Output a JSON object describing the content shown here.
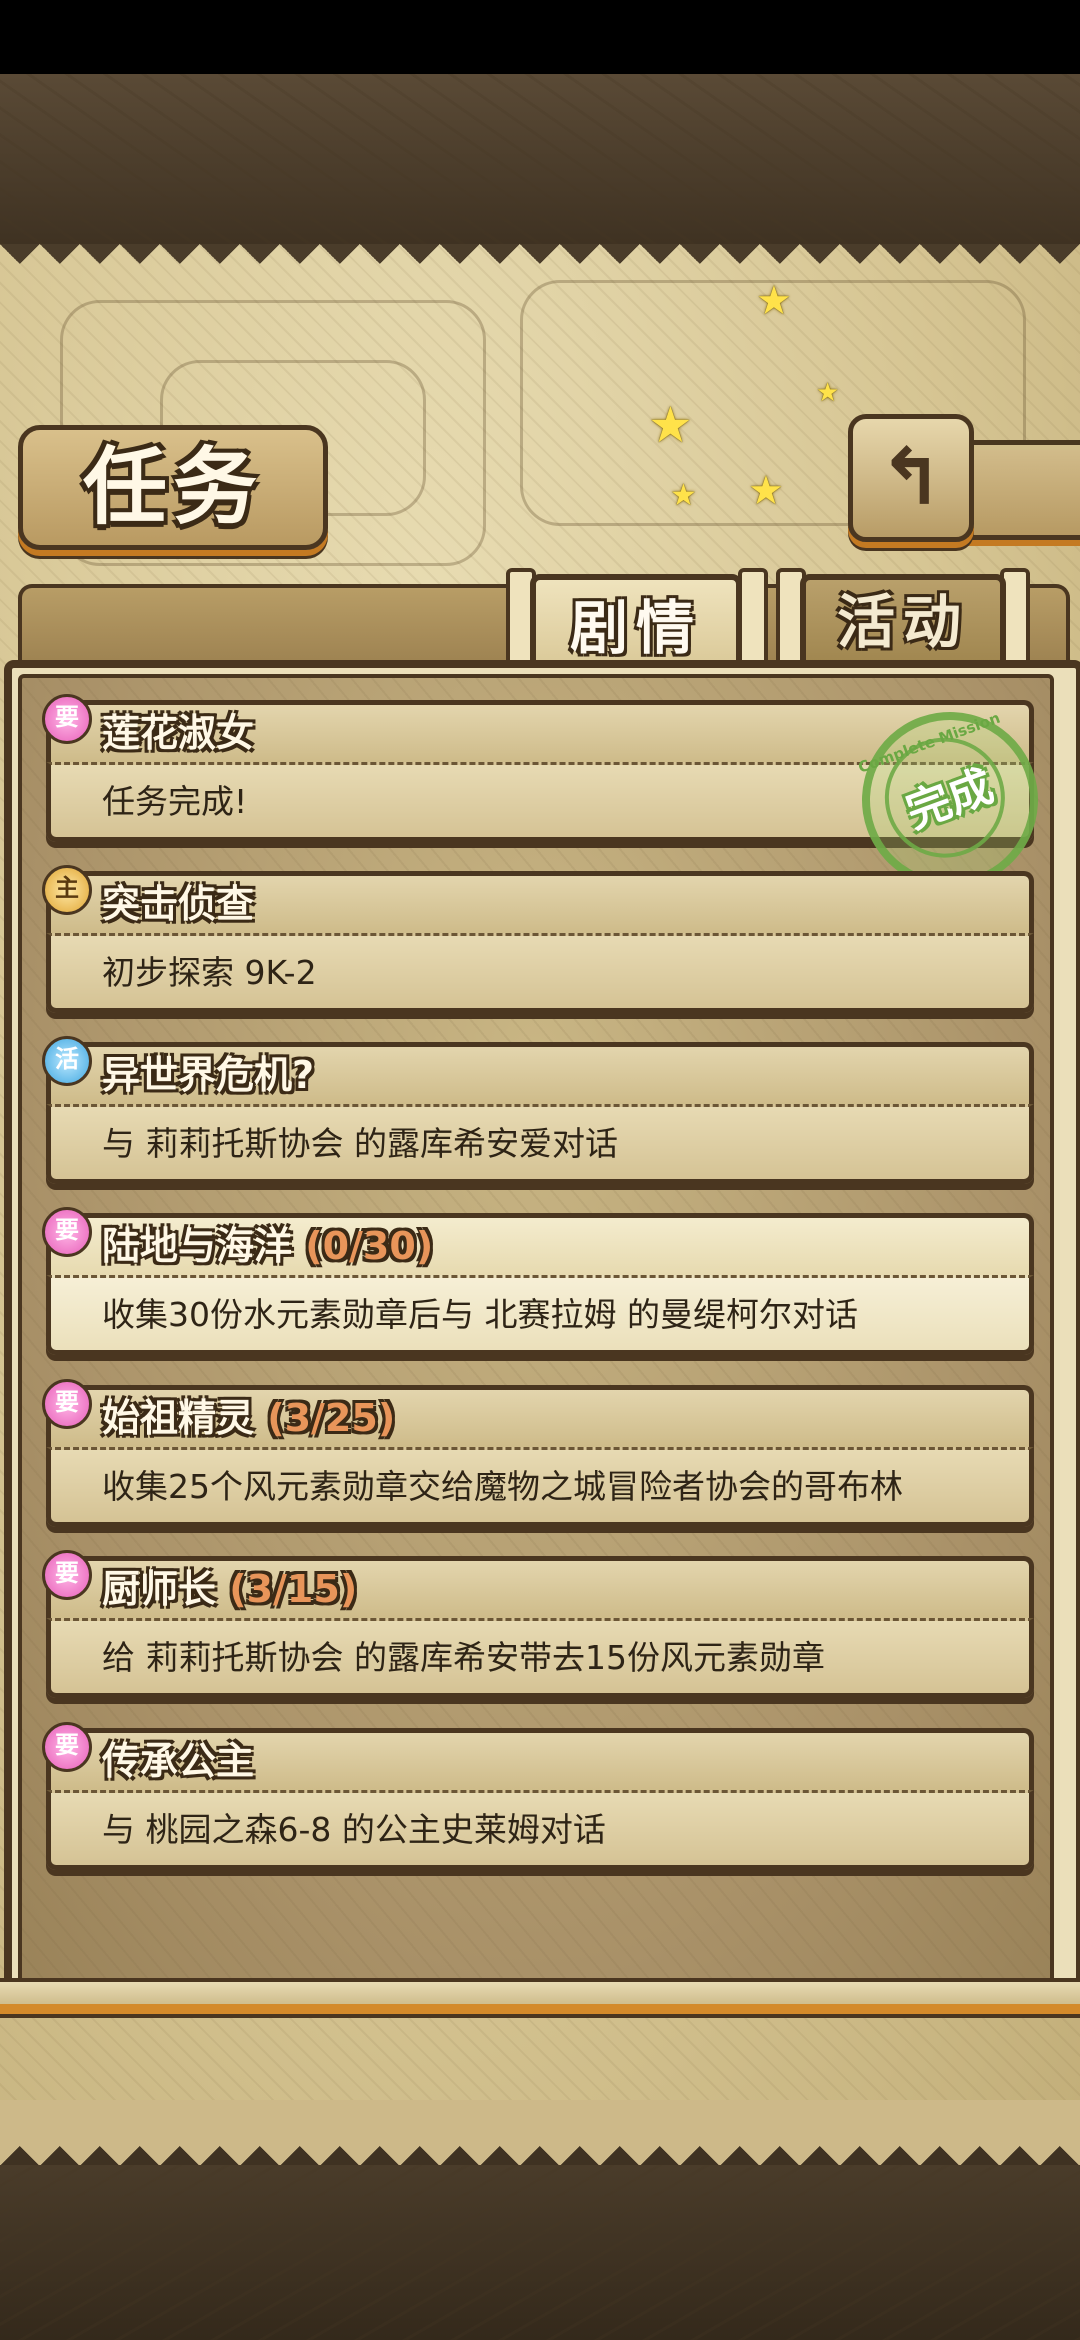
{
  "header": {
    "title": "任务",
    "back_icon": "return-arrow-icon"
  },
  "tabs": [
    {
      "label": "剧情",
      "active": true
    },
    {
      "label": "活动",
      "active": false
    }
  ],
  "quests": [
    {
      "tag": "要",
      "tag_type": "required",
      "name": "莲花淑女",
      "progress": "",
      "desc": "任务完成!",
      "completed": true,
      "stamp_text": "完成",
      "stamp_arc": "Complete Mission"
    },
    {
      "tag": "主",
      "tag_type": "main",
      "name": "突击侦查",
      "progress": "",
      "desc": "初步探索 9K-2",
      "completed": false
    },
    {
      "tag": "活",
      "tag_type": "event",
      "name": "异世界危机?",
      "progress": "",
      "desc": "与 莉莉托斯协会 的露库希安爱对话",
      "completed": false
    },
    {
      "tag": "要",
      "tag_type": "required",
      "name": "陆地与海洋",
      "progress": "(0/30)",
      "desc": "收集30份水元素勋章后与 北赛拉姆 的曼缇柯尔对话",
      "completed": false,
      "highlight": true
    },
    {
      "tag": "要",
      "tag_type": "required",
      "name": "始祖精灵",
      "progress": "(3/25)",
      "desc": "收集25个风元素勋章交给魔物之城冒险者协会的哥布林",
      "completed": false
    },
    {
      "tag": "要",
      "tag_type": "required",
      "name": "厨师长",
      "progress": "(3/15)",
      "desc": "给 莉莉托斯协会 的露库希安带去15份风元素勋章",
      "completed": false
    },
    {
      "tag": "要",
      "tag_type": "required",
      "name": "传承公主",
      "progress": "",
      "desc": "与 桃园之森6-8 的公主史莱姆对话",
      "completed": false
    }
  ],
  "colors": {
    "frame": "#4a3620",
    "parchment": "#e3d5ad",
    "progress": "#e8955a",
    "stamp": "#6aa843"
  }
}
